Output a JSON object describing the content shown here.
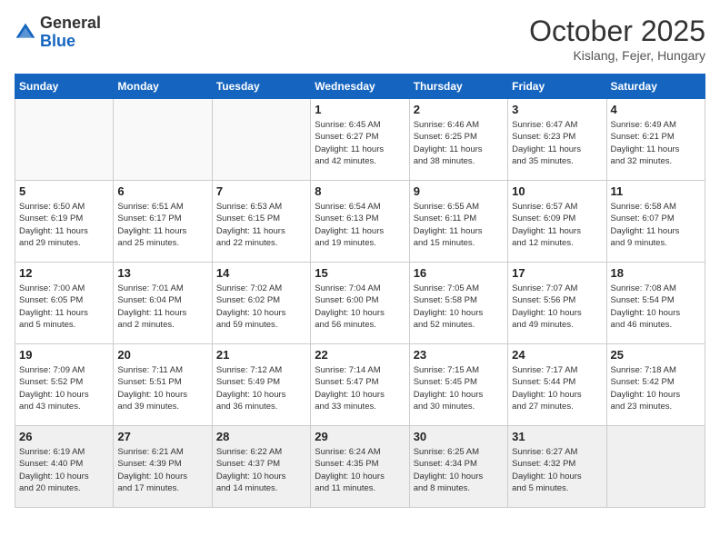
{
  "header": {
    "logo_general": "General",
    "logo_blue": "Blue",
    "month_title": "October 2025",
    "location": "Kislang, Fejer, Hungary"
  },
  "days_of_week": [
    "Sunday",
    "Monday",
    "Tuesday",
    "Wednesday",
    "Thursday",
    "Friday",
    "Saturday"
  ],
  "weeks": [
    [
      {
        "day": "",
        "info": ""
      },
      {
        "day": "",
        "info": ""
      },
      {
        "day": "",
        "info": ""
      },
      {
        "day": "1",
        "info": "Sunrise: 6:45 AM\nSunset: 6:27 PM\nDaylight: 11 hours\nand 42 minutes."
      },
      {
        "day": "2",
        "info": "Sunrise: 6:46 AM\nSunset: 6:25 PM\nDaylight: 11 hours\nand 38 minutes."
      },
      {
        "day": "3",
        "info": "Sunrise: 6:47 AM\nSunset: 6:23 PM\nDaylight: 11 hours\nand 35 minutes."
      },
      {
        "day": "4",
        "info": "Sunrise: 6:49 AM\nSunset: 6:21 PM\nDaylight: 11 hours\nand 32 minutes."
      }
    ],
    [
      {
        "day": "5",
        "info": "Sunrise: 6:50 AM\nSunset: 6:19 PM\nDaylight: 11 hours\nand 29 minutes."
      },
      {
        "day": "6",
        "info": "Sunrise: 6:51 AM\nSunset: 6:17 PM\nDaylight: 11 hours\nand 25 minutes."
      },
      {
        "day": "7",
        "info": "Sunrise: 6:53 AM\nSunset: 6:15 PM\nDaylight: 11 hours\nand 22 minutes."
      },
      {
        "day": "8",
        "info": "Sunrise: 6:54 AM\nSunset: 6:13 PM\nDaylight: 11 hours\nand 19 minutes."
      },
      {
        "day": "9",
        "info": "Sunrise: 6:55 AM\nSunset: 6:11 PM\nDaylight: 11 hours\nand 15 minutes."
      },
      {
        "day": "10",
        "info": "Sunrise: 6:57 AM\nSunset: 6:09 PM\nDaylight: 11 hours\nand 12 minutes."
      },
      {
        "day": "11",
        "info": "Sunrise: 6:58 AM\nSunset: 6:07 PM\nDaylight: 11 hours\nand 9 minutes."
      }
    ],
    [
      {
        "day": "12",
        "info": "Sunrise: 7:00 AM\nSunset: 6:05 PM\nDaylight: 11 hours\nand 5 minutes."
      },
      {
        "day": "13",
        "info": "Sunrise: 7:01 AM\nSunset: 6:04 PM\nDaylight: 11 hours\nand 2 minutes."
      },
      {
        "day": "14",
        "info": "Sunrise: 7:02 AM\nSunset: 6:02 PM\nDaylight: 10 hours\nand 59 minutes."
      },
      {
        "day": "15",
        "info": "Sunrise: 7:04 AM\nSunset: 6:00 PM\nDaylight: 10 hours\nand 56 minutes."
      },
      {
        "day": "16",
        "info": "Sunrise: 7:05 AM\nSunset: 5:58 PM\nDaylight: 10 hours\nand 52 minutes."
      },
      {
        "day": "17",
        "info": "Sunrise: 7:07 AM\nSunset: 5:56 PM\nDaylight: 10 hours\nand 49 minutes."
      },
      {
        "day": "18",
        "info": "Sunrise: 7:08 AM\nSunset: 5:54 PM\nDaylight: 10 hours\nand 46 minutes."
      }
    ],
    [
      {
        "day": "19",
        "info": "Sunrise: 7:09 AM\nSunset: 5:52 PM\nDaylight: 10 hours\nand 43 minutes."
      },
      {
        "day": "20",
        "info": "Sunrise: 7:11 AM\nSunset: 5:51 PM\nDaylight: 10 hours\nand 39 minutes."
      },
      {
        "day": "21",
        "info": "Sunrise: 7:12 AM\nSunset: 5:49 PM\nDaylight: 10 hours\nand 36 minutes."
      },
      {
        "day": "22",
        "info": "Sunrise: 7:14 AM\nSunset: 5:47 PM\nDaylight: 10 hours\nand 33 minutes."
      },
      {
        "day": "23",
        "info": "Sunrise: 7:15 AM\nSunset: 5:45 PM\nDaylight: 10 hours\nand 30 minutes."
      },
      {
        "day": "24",
        "info": "Sunrise: 7:17 AM\nSunset: 5:44 PM\nDaylight: 10 hours\nand 27 minutes."
      },
      {
        "day": "25",
        "info": "Sunrise: 7:18 AM\nSunset: 5:42 PM\nDaylight: 10 hours\nand 23 minutes."
      }
    ],
    [
      {
        "day": "26",
        "info": "Sunrise: 6:19 AM\nSunset: 4:40 PM\nDaylight: 10 hours\nand 20 minutes."
      },
      {
        "day": "27",
        "info": "Sunrise: 6:21 AM\nSunset: 4:39 PM\nDaylight: 10 hours\nand 17 minutes."
      },
      {
        "day": "28",
        "info": "Sunrise: 6:22 AM\nSunset: 4:37 PM\nDaylight: 10 hours\nand 14 minutes."
      },
      {
        "day": "29",
        "info": "Sunrise: 6:24 AM\nSunset: 4:35 PM\nDaylight: 10 hours\nand 11 minutes."
      },
      {
        "day": "30",
        "info": "Sunrise: 6:25 AM\nSunset: 4:34 PM\nDaylight: 10 hours\nand 8 minutes."
      },
      {
        "day": "31",
        "info": "Sunrise: 6:27 AM\nSunset: 4:32 PM\nDaylight: 10 hours\nand 5 minutes."
      },
      {
        "day": "",
        "info": ""
      }
    ]
  ]
}
